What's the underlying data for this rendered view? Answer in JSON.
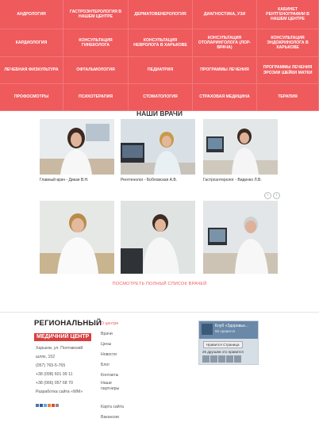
{
  "menu": {
    "rows": [
      [
        "Андрология",
        "Гастроэнтерология в нашем центре",
        "Дерматовенерология",
        "Диагностика, УЗИ",
        "Кабинет рентгенографии в нашем центре"
      ],
      [
        "Кардиология",
        "Консультация гинеколога",
        "Консультация невролога в Харькове",
        "Консультация отоларинголога (лор-врача)",
        "Консультация эндокринолога в Харькове"
      ],
      [
        "Лечебная физкультура",
        "Офтальмология",
        "Педиатрия",
        "Программы лечения",
        "Программы лечения эрозии шейки матки"
      ],
      [
        "Профосмотры",
        "Психотерапия",
        "Стоматология",
        "Страховая медицина",
        "Терапия"
      ]
    ]
  },
  "doctors": {
    "title": "НАШИ ВРАЧИ",
    "items": [
      {
        "caption": "Главный врач - Дикая В.Н."
      },
      {
        "caption": "Рентгенолог - Бобловская А.В."
      },
      {
        "caption": "Гастроэнтеролог - Виденко Л.В."
      },
      {
        "caption": ""
      },
      {
        "caption": ""
      },
      {
        "caption": ""
      }
    ],
    "prev": "‹",
    "next": "›",
    "all_link": "Посмотреть полный список врачей"
  },
  "footer": {
    "logo_line1": "РЕГИОНАЛЬНЫЙ",
    "logo_line2": "МЕДИЧНИЙ ЦЕНТР",
    "address1": "Харьков, ул. Полтавский",
    "address2": "шлях, 152",
    "phone1": "(057) 765-5-765",
    "phone2": "+38 (098) 601 99 11",
    "phone3": "+38 (066) 057 68 70",
    "dev": "Разработка сайта «WM»",
    "links": [
      "О центре",
      "Врачи",
      "Цены",
      "Новости",
      "Блог",
      "Контакты",
      "Наши",
      "партнеры",
      "",
      "Карта сайта",
      "Вакансии"
    ],
    "widget": {
      "title": "Клуб «Здоровье...",
      "likes": "55 нравится",
      "like_button": "Нравится Страница",
      "friends": "26 друзьям это нравится"
    }
  },
  "colors": {
    "accent": "#ef5a5d",
    "logo_red": "#d83f3f"
  }
}
